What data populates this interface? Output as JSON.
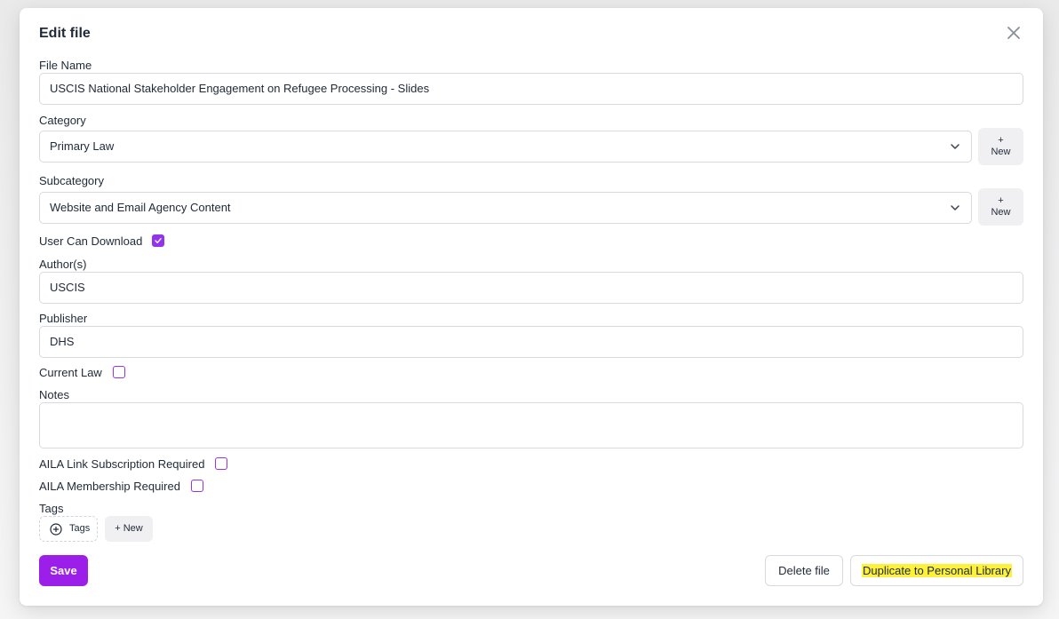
{
  "modal": {
    "title": "Edit file",
    "close_icon": "close-icon"
  },
  "form": {
    "file_name": {
      "label": "File Name",
      "value": "USCIS National Stakeholder Engagement on Refugee Processing - Slides"
    },
    "category": {
      "label": "Category",
      "value": "Primary Law",
      "new_plus": "+",
      "new_label": "New"
    },
    "subcategory": {
      "label": "Subcategory",
      "value": "Website and Email Agency Content",
      "new_plus": "+",
      "new_label": "New"
    },
    "user_can_download": {
      "label": "User Can Download",
      "checked": true
    },
    "authors": {
      "label": "Author(s)",
      "value": "USCIS"
    },
    "publisher": {
      "label": "Publisher",
      "value": "DHS"
    },
    "current_law": {
      "label": "Current Law",
      "checked": false
    },
    "notes": {
      "label": "Notes",
      "value": ""
    },
    "aila_link_subscription": {
      "label": "AILA Link Subscription Required",
      "checked": false
    },
    "aila_membership": {
      "label": "AILA Membership Required",
      "checked": false
    },
    "tags": {
      "label": "Tags",
      "button_label": "Tags",
      "new_label": "+ New"
    }
  },
  "footer": {
    "save_label": "Save",
    "delete_label": "Delete file",
    "duplicate_label": "Duplicate to Personal Library"
  },
  "colors": {
    "accent": "#9b1fe8",
    "highlight": "#fdf13b"
  }
}
